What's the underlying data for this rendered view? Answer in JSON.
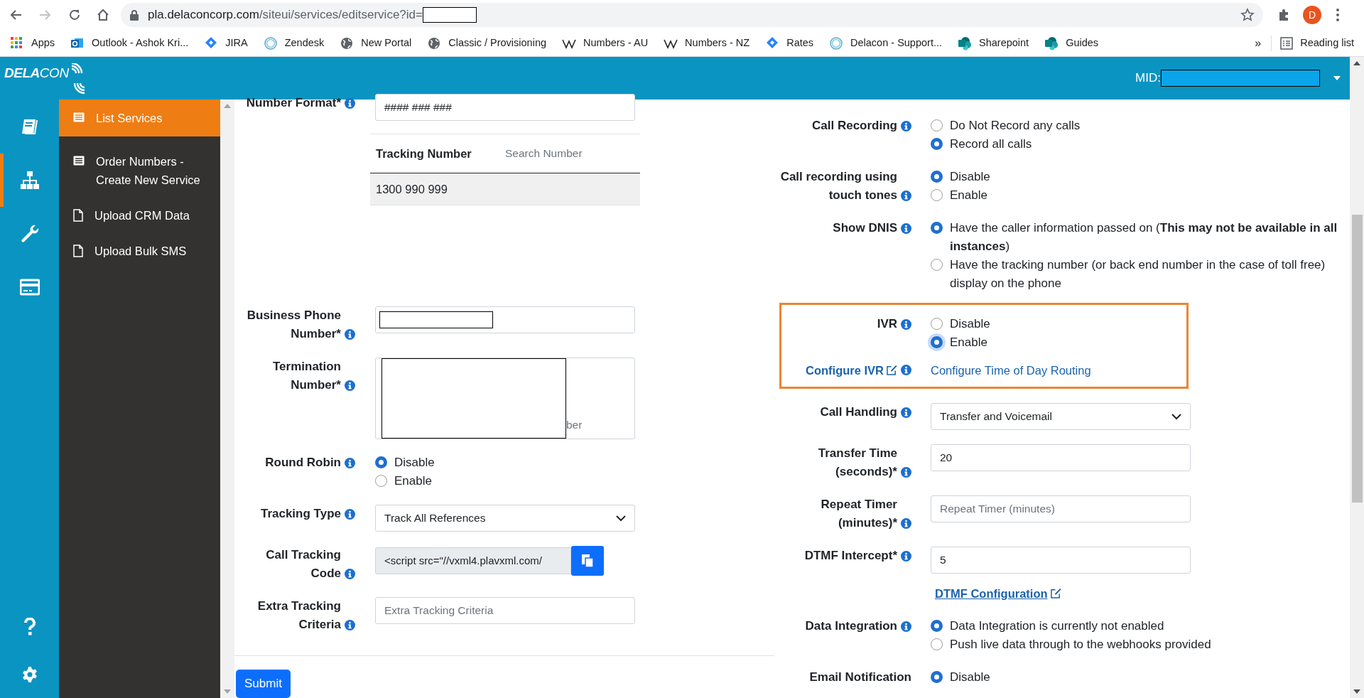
{
  "browser": {
    "back_enabled": true,
    "forward_enabled": false,
    "url_host": "pla.delaconcorp.com",
    "url_path": "/siteui/services/editservice?id=",
    "url_redacted": true,
    "profile_initial": "D"
  },
  "bookmarks": [
    {
      "label": "Apps",
      "kind": "grid"
    },
    {
      "label": "Outlook - Ashok Kri...",
      "kind": "mail"
    },
    {
      "label": "JIRA",
      "kind": "diamond"
    },
    {
      "label": "Zendesk",
      "kind": "ring"
    },
    {
      "label": "New Portal",
      "kind": "globe"
    },
    {
      "label": "Classic / Provisioning",
      "kind": "globe"
    },
    {
      "label": "Numbers - AU",
      "kind": "wiki"
    },
    {
      "label": "Numbers - NZ",
      "kind": "wiki"
    },
    {
      "label": "Rates",
      "kind": "diamond"
    },
    {
      "label": "Delacon - Support...",
      "kind": "ring"
    },
    {
      "label": "Sharepoint",
      "kind": "site"
    },
    {
      "label": "Guides",
      "kind": "site"
    }
  ],
  "bookmarks_overflow": "»",
  "reading_list": "Reading list",
  "header": {
    "logo": "**DELA**CON",
    "mid_label": "MID:",
    "mid_redacted": true
  },
  "rail": [
    {
      "kind": "book",
      "selected": false
    },
    {
      "kind": "sitemap",
      "selected": true
    },
    {
      "kind": "wrench",
      "selected": false
    },
    {
      "kind": "card",
      "selected": false
    }
  ],
  "rail_bottom": [
    {
      "kind": "help"
    },
    {
      "kind": "settings"
    }
  ],
  "sidebar": {
    "items": [
      {
        "label": "List Services",
        "kind": "list",
        "selected": true
      },
      {
        "label": "Order Numbers - Create New Service",
        "kind": "list",
        "selected": false
      },
      {
        "label": "Upload CRM Data",
        "kind": "file",
        "selected": false
      },
      {
        "label": "Upload Bulk SMS",
        "kind": "file",
        "selected": false
      }
    ]
  },
  "left_form": [
    {
      "kind": "input",
      "label": "Number Format*",
      "value": "#### ### ###"
    },
    {
      "kind": "number_table",
      "column": "Tracking Number",
      "search_placeholder": "Search Number",
      "rows": [
        "1300 990 999"
      ]
    },
    {
      "kind": "input",
      "label": "Business Phone Number*",
      "redacted": true
    },
    {
      "kind": "textarea",
      "label": "Termination Number*",
      "visible_placeholder": "ber",
      "redacted": true
    },
    {
      "kind": "radio",
      "label": "Round Robin",
      "options": [
        {
          "label": "Disable",
          "selected": true
        },
        {
          "label": "Enable",
          "selected": false
        }
      ]
    },
    {
      "kind": "select",
      "label": "Tracking Type",
      "value": "Track All References"
    },
    {
      "kind": "code",
      "label": "Call Tracking Code",
      "value": "<script src=\"//vxml4.plavxml.com/"
    },
    {
      "kind": "input",
      "label": "Extra Tracking Criteria",
      "placeholder": "Extra Tracking Criteria"
    }
  ],
  "submit": "Submit",
  "right_form": [
    {
      "kind": "radio",
      "label": "Call Recording",
      "options": [
        {
          "label": "Do Not Record any calls",
          "selected": false
        },
        {
          "label": "Record all calls",
          "selected": true
        }
      ]
    },
    {
      "kind": "radio",
      "label": "Call recording using touch tones",
      "options": [
        {
          "label": "Disable",
          "selected": true
        },
        {
          "label": "Enable",
          "selected": false
        }
      ]
    },
    {
      "kind": "radio",
      "label": "Show DNIS",
      "options": [
        {
          "label": "Have the caller information passed on (**This may not be available in all instances**)",
          "selected": true
        },
        {
          "label": "Have the tracking number (or back end number in the case of toll free) display on the phone",
          "selected": false
        }
      ]
    },
    {
      "kind": "highlight",
      "rows": [
        {
          "kind": "radio",
          "label": "IVR",
          "options": [
            {
              "label": "Disable",
              "selected": false
            },
            {
              "label": "Enable",
              "selected": true,
              "focused": true
            }
          ]
        },
        {
          "kind": "links",
          "link": "Configure IVR",
          "second_link": "Configure Time of Day Routing"
        }
      ]
    },
    {
      "kind": "select",
      "label": "Call Handling",
      "value": "Transfer and Voicemail"
    },
    {
      "kind": "input",
      "label": "Transfer Time (seconds)*",
      "value": "20"
    },
    {
      "kind": "input",
      "label": "Repeat Timer (minutes)*",
      "placeholder": "Repeat Timer (minutes)"
    },
    {
      "kind": "input",
      "label": "DTMF Intercept*",
      "value": "5",
      "link": "DTMF Configuration"
    },
    {
      "kind": "radio",
      "label": "Data Integration",
      "options": [
        {
          "label": "Data Integration is currently not enabled",
          "selected": true
        },
        {
          "label": "Push live data through to the webhooks provided",
          "selected": false
        }
      ]
    },
    {
      "kind": "radio",
      "label": "Email Notification",
      "noinfo": true,
      "options": [
        {
          "label": "Disable",
          "selected": true
        }
      ]
    }
  ]
}
